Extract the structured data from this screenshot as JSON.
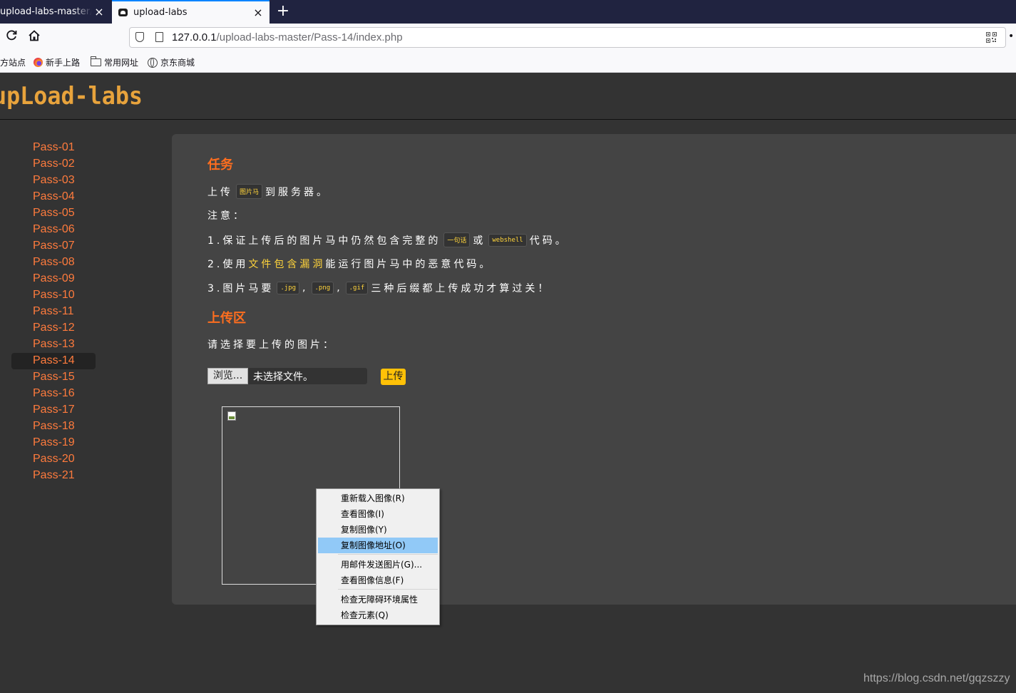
{
  "browser": {
    "tabs": [
      {
        "title": "upload-labs-master/in",
        "active": false
      },
      {
        "title": "upload-labs",
        "active": true
      }
    ],
    "url_host": "127.0.0.1",
    "url_path": "/upload-labs-master/Pass-14/index.php",
    "bookmarks": [
      "方站点",
      "新手上路",
      "常用网址",
      "京东商城"
    ],
    "close_glyph": "×",
    "new_tab_glyph": "+",
    "more_glyph": "••"
  },
  "site": {
    "logo_text": "upLoad-labs",
    "logo_color": "#e8a33c"
  },
  "sidebar": {
    "active_index": 13,
    "items": [
      "Pass-01",
      "Pass-02",
      "Pass-03",
      "Pass-04",
      "Pass-05",
      "Pass-06",
      "Pass-07",
      "Pass-08",
      "Pass-09",
      "Pass-10",
      "Pass-11",
      "Pass-12",
      "Pass-13",
      "Pass-14",
      "Pass-15",
      "Pass-16",
      "Pass-17",
      "Pass-18",
      "Pass-19",
      "Pass-20",
      "Pass-21"
    ]
  },
  "task": {
    "heading": "任务",
    "line1_pre": "上传",
    "line1_code": "图片马",
    "line1_post": "到服务器。",
    "note_label": "注意：",
    "note1_pre": "1.保证上传后的图片马中仍然包含完整的",
    "note1_code1": "一句话",
    "note1_mid": "或",
    "note1_code2": "webshell",
    "note1_post": "代码。",
    "note2_pre": "2.使用",
    "note2_hl": "文件包含漏洞",
    "note2_post": "能运行图片马中的恶意代码。",
    "note3_pre": "3.图片马要",
    "note3_code1": ".jpg",
    "note3_sep1": ",",
    "note3_code2": ".png",
    "note3_sep2": ",",
    "note3_code3": ".gif",
    "note3_post": "三种后缀都上传成功才算过关！"
  },
  "upload": {
    "heading": "上传区",
    "prompt": "请选择要上传的图片：",
    "browse_label": "浏览...",
    "file_label": "未选择文件。",
    "submit_label": "上传"
  },
  "context_menu": {
    "hover_index": 3,
    "items": [
      "重新载入图像(R)",
      "查看图像(I)",
      "复制图像(Y)",
      "复制图像地址(O)",
      "用邮件发送图片(G)...",
      "查看图像信息(F)",
      "检查无障碍环境属性",
      "检查元素(Q)"
    ]
  },
  "watermark": "https://blog.csdn.net/gqzszzy"
}
